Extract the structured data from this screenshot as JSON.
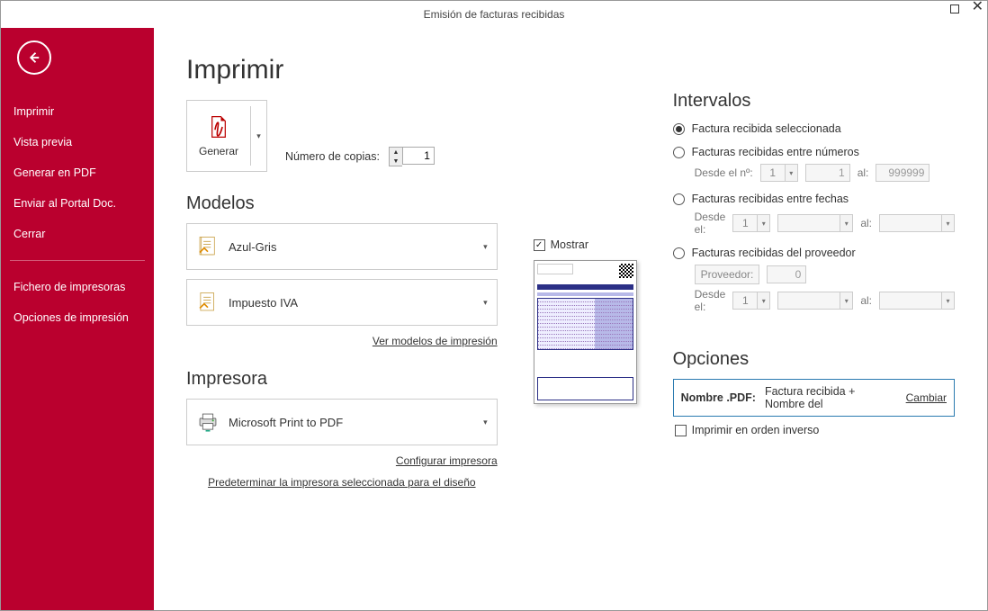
{
  "window": {
    "title": "Emisión de facturas recibidas"
  },
  "sidebar": {
    "items": [
      "Imprimir",
      "Vista previa",
      "Generar en PDF",
      "Enviar al Portal Doc.",
      "Cerrar"
    ],
    "items2": [
      "Fichero de impresoras",
      "Opciones de impresión"
    ]
  },
  "page": {
    "title": "Imprimir"
  },
  "generate": {
    "label": "Generar",
    "copies_label": "Número de copias:",
    "copies_value": "1"
  },
  "models": {
    "heading": "Modelos",
    "model1": "Azul-Gris",
    "model2": "Impuesto IVA",
    "link": "Ver modelos de impresión",
    "show_label": "Mostrar"
  },
  "printer": {
    "heading": "Impresora",
    "name": "Microsoft Print to PDF",
    "configure": "Configurar impresora",
    "set_default": "Predeterminar la impresora seleccionada para el diseño"
  },
  "intervals": {
    "heading": "Intervalos",
    "r1": "Factura recibida seleccionada",
    "r2": "Facturas recibidas entre números",
    "r3": "Facturas recibidas entre fechas",
    "r4": "Facturas recibidas del proveedor",
    "from_num": "Desde el nº:",
    "to": "al:",
    "from_date": "Desde el:",
    "provider": "Proveedor:",
    "num_from_serie": "1",
    "num_from": "1",
    "num_to": "999999",
    "date_serie": "1",
    "prov_serie": "1",
    "prov_code": "0"
  },
  "options": {
    "heading": "Opciones",
    "pdf_key": "Nombre .PDF:",
    "pdf_val": "Factura recibida + Nombre del",
    "change": "Cambiar",
    "reverse": "Imprimir en orden inverso"
  }
}
